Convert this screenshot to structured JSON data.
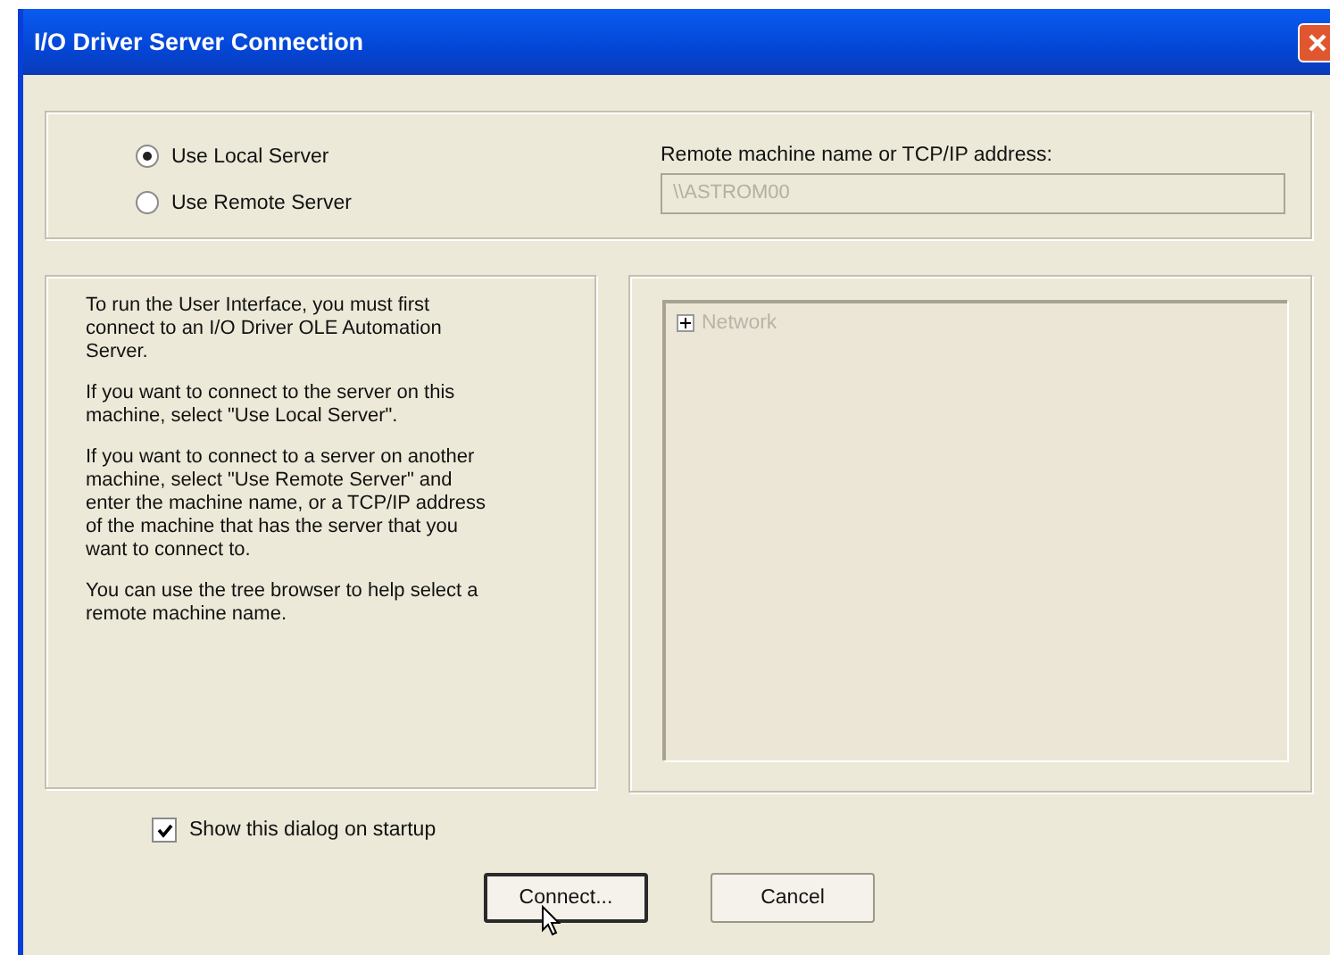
{
  "window": {
    "title": "I/O Driver Server Connection"
  },
  "server_options": [
    {
      "label": "Use Local Server",
      "selected": true
    },
    {
      "label": "Use Remote Server",
      "selected": false
    }
  ],
  "remote_field": {
    "label": "Remote machine name or TCP/IP address:",
    "value": "\\\\ASTROM00",
    "disabled": true
  },
  "help_paragraphs": [
    "To run the User Interface, you must first connect to an  I/O Driver OLE Automation Server.",
    "If you want to connect to the server on this machine, select \"Use Local Server\".",
    "If you want to connect to a server on another machine, select \"Use Remote Server\" and enter the machine name, or a TCP/IP address of the machine that has the server that you want to connect to.",
    "You can use the tree browser to help select a remote machine name."
  ],
  "tree": {
    "disabled": true,
    "items": [
      {
        "label": "Network",
        "expanded": false
      }
    ]
  },
  "startup_checkbox": {
    "label": "Show this dialog on startup",
    "checked": true
  },
  "buttons": [
    {
      "label": "Connect...",
      "kind": "default"
    },
    {
      "label": "Cancel",
      "kind": "normal"
    }
  ]
}
